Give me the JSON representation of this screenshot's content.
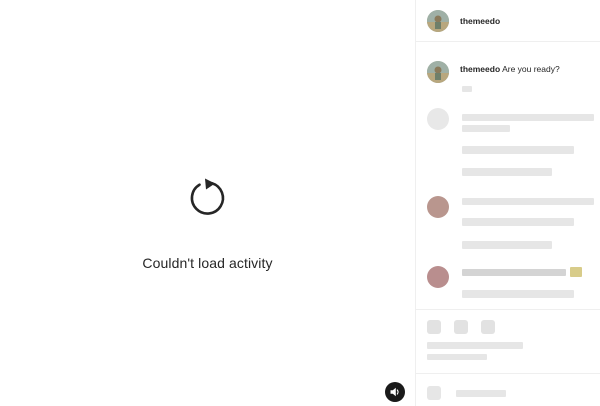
{
  "media": {
    "reload_icon": "reload-icon",
    "error_message": "Couldn't load activity",
    "sound_icon": "speaker-icon"
  },
  "header": {
    "username": "themeedo"
  },
  "comments": [
    {
      "username": "themeedo",
      "text": "Are you ready?"
    }
  ]
}
